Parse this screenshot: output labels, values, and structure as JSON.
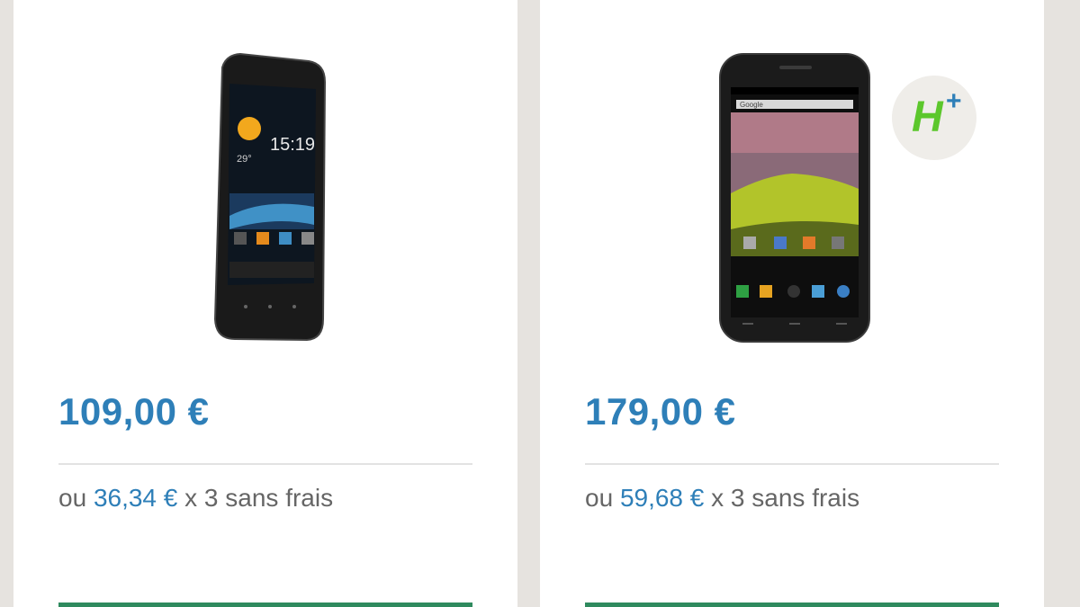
{
  "products": [
    {
      "price": "109,00 €",
      "installment_prefix": "ou",
      "installment_amount": "36,34 €",
      "installment_suffix": "x 3 sans frais",
      "screen_time": "15:19",
      "screen_temp": "29°"
    },
    {
      "price": "179,00 €",
      "installment_prefix": "ou",
      "installment_amount": "59,68 €",
      "installment_suffix": "x 3 sans frais",
      "badge_letter": "H",
      "badge_sup": "+",
      "search_placeholder": "Google"
    }
  ],
  "colors": {
    "price_blue": "#2e7fb8",
    "background": "#e6e3df",
    "cta_green": "#2f8a5e",
    "badge_green": "#5cc72c"
  }
}
